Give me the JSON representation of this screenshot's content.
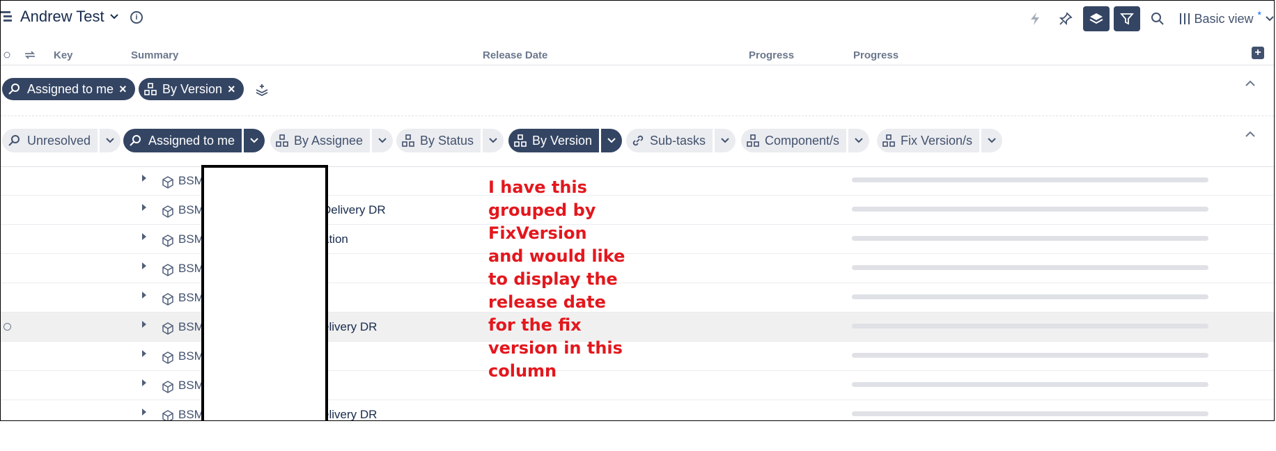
{
  "header": {
    "title": "Andrew Test",
    "view_label": "Basic view",
    "view_star": "*"
  },
  "columns": {
    "key": "Key",
    "summary": "Summary",
    "release_date": "Release Date",
    "progress1": "Progress",
    "progress2": "Progress"
  },
  "active_filters": [
    {
      "label": "Assigned to me"
    },
    {
      "label": "By Version"
    }
  ],
  "options": [
    {
      "label": "Unresolved",
      "active": false
    },
    {
      "label": "Assigned to me",
      "active": true
    },
    {
      "label": "By Assignee",
      "active": false
    },
    {
      "label": "By Status",
      "active": false
    },
    {
      "label": "By Version",
      "active": true
    },
    {
      "label": "Sub-tasks",
      "active": false
    },
    {
      "label": "Component/s",
      "active": false
    },
    {
      "label": "Fix Version/s",
      "active": false
    }
  ],
  "rows": [
    {
      "key": "BSM",
      "summary": ""
    },
    {
      "key": "BSM",
      "summary": "Delivery DR"
    },
    {
      "key": "BSM",
      "summary": "ation"
    },
    {
      "key": "BSM",
      "summary": ""
    },
    {
      "key": "BSM",
      "summary": ""
    },
    {
      "key": "BSM",
      "summary": "elivery DR"
    },
    {
      "key": "BSM",
      "summary": ""
    },
    {
      "key": "BSM",
      "summary": ""
    },
    {
      "key": "BSM",
      "summary": "elivery DR"
    }
  ],
  "annotation": "I have this grouped by FixVersion and would like to display the release date for the fix version in this column",
  "colors": {
    "accent": "#344563",
    "annotation": "#e3171d"
  }
}
